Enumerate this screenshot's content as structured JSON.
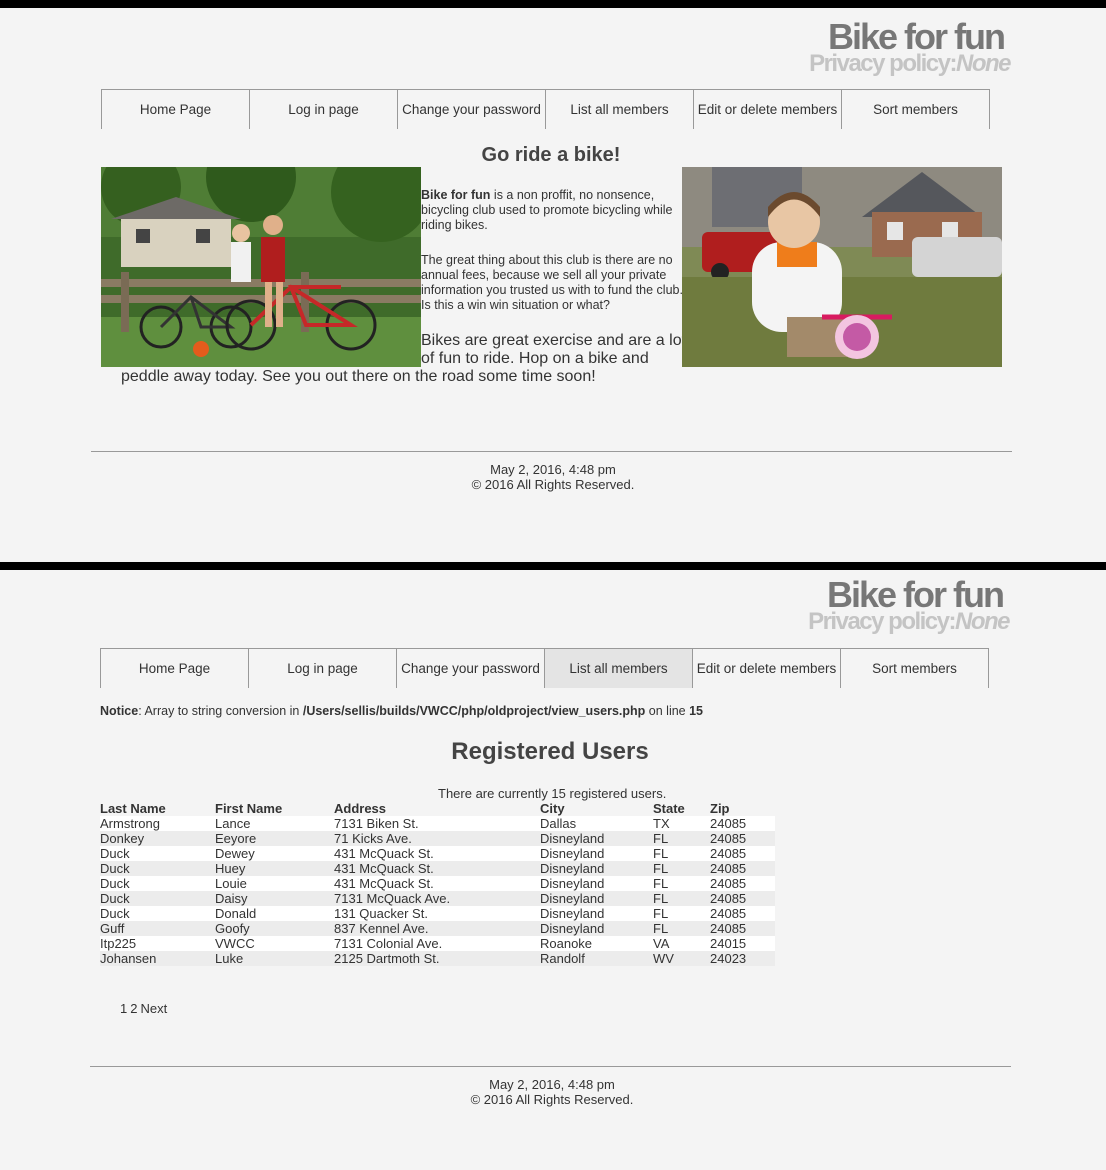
{
  "site": {
    "title": "Bike for fun",
    "subtitle_prefix": "Privacy policy:",
    "subtitle_value": "None"
  },
  "nav": [
    "Home Page",
    "Log in page",
    "Change your password",
    "List all members",
    "Edit or delete members",
    "Sort members"
  ],
  "home": {
    "heading": "Go ride a bike!",
    "intro_bold": "Bike for fun",
    "intro_rest": " is a non proffit, no nonsence, bicycling club used to promote bicycling while riding bikes.",
    "para2": "The great thing about this club is there are no annual fees, because we sell all your private information you trusted us with to fund the club. Is this a win win situation or what?",
    "para3_line1": "Bikes are great exercise and are a lot",
    "para3_line2": "of fun to ride. Hop on a bike and",
    "para3_line3": "peddle away today. See you out there on the road some time soon!"
  },
  "users_page": {
    "notice_label": "Notice",
    "notice_text": ": Array to string conversion in ",
    "notice_path": "/Users/sellis/builds/VWCC/php/oldproject/view_users.php",
    "notice_on_line": " on line ",
    "notice_line": "15",
    "heading": "Registered Users",
    "count_text": "There are currently 15 registered users.",
    "columns": [
      "Last Name",
      "First Name",
      "Address",
      "City",
      "State",
      "Zip"
    ],
    "rows": [
      [
        "Armstrong",
        "Lance",
        "7131 Biken St.",
        "Dallas",
        "TX",
        "24085"
      ],
      [
        "Donkey",
        "Eeyore",
        "71 Kicks Ave.",
        "Disneyland",
        "FL",
        "24085"
      ],
      [
        "Duck",
        "Dewey",
        "431 McQuack St.",
        "Disneyland",
        "FL",
        "24085"
      ],
      [
        "Duck",
        "Huey",
        "431 McQuack St.",
        "Disneyland",
        "FL",
        "24085"
      ],
      [
        "Duck",
        "Louie",
        "431 McQuack St.",
        "Disneyland",
        "FL",
        "24085"
      ],
      [
        "Duck",
        "Daisy",
        "7131 McQuack Ave.",
        "Disneyland",
        "FL",
        "24085"
      ],
      [
        "Duck",
        "Donald",
        "131 Quacker St.",
        "Disneyland",
        "FL",
        "24085"
      ],
      [
        "Guff",
        "Goofy",
        "837 Kennel Ave.",
        "Disneyland",
        "FL",
        "24085"
      ],
      [
        "Itp225",
        "VWCC",
        "7131 Colonial Ave.",
        "Roanoke",
        "VA",
        "24015"
      ],
      [
        "Johansen",
        "Luke",
        "2125 Dartmoth St.",
        "Randolf",
        "WV",
        "24023"
      ]
    ],
    "pager": [
      "1",
      "2",
      "Next"
    ]
  },
  "footer": {
    "date": "May 2, 2016, 4:48 pm",
    "copyright": "© 2016 All Rights Reserved."
  }
}
